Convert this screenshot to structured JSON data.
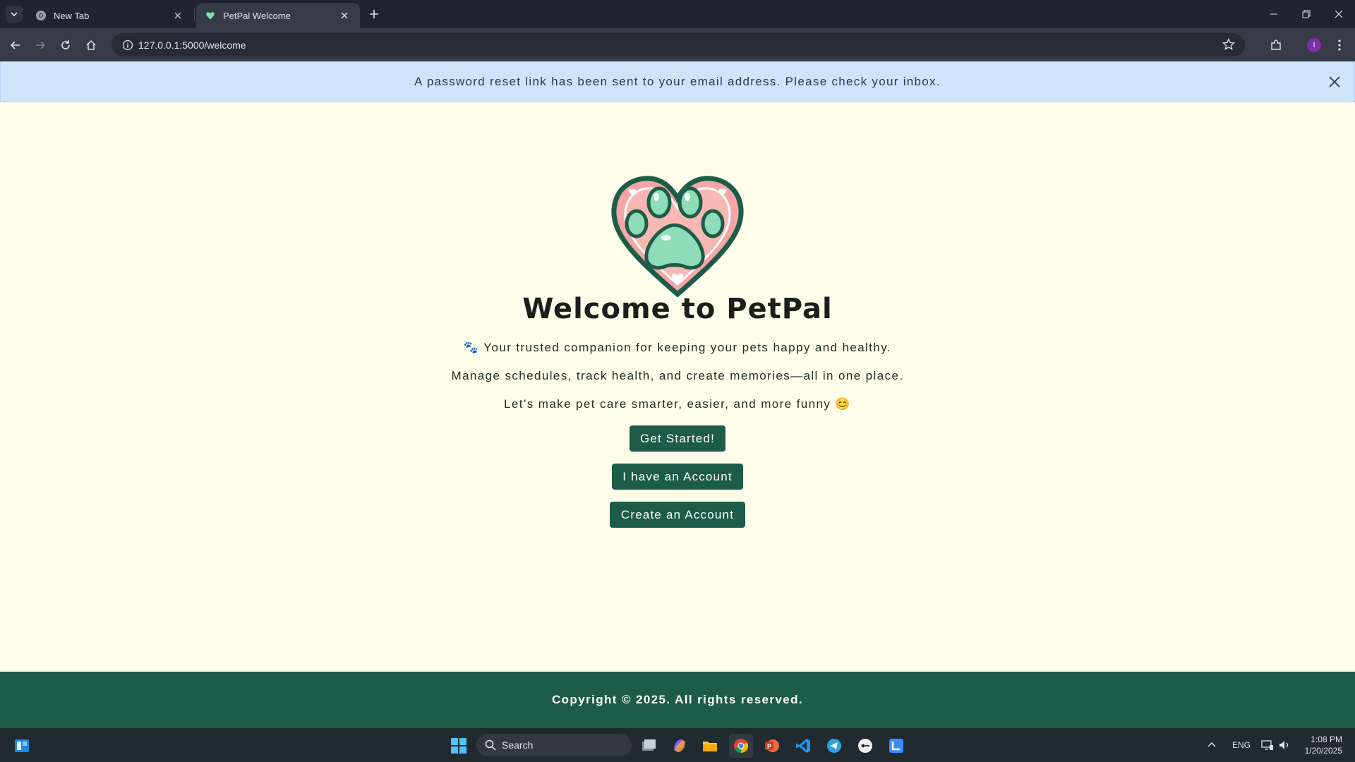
{
  "browser": {
    "tabs": [
      {
        "title": "New Tab",
        "active": false
      },
      {
        "title": "PetPal Welcome",
        "active": true
      }
    ],
    "url": "127.0.0.1:5000/welcome",
    "profile_initial": "I"
  },
  "flash": {
    "message": "A password reset link has been sent to your email address. Please check your inbox."
  },
  "hero": {
    "title": "Welcome to PetPal",
    "line1": "🐾 Your trusted companion for keeping your pets happy and healthy.",
    "line2": "Manage schedules, track health, and create memories—all in one place.",
    "line3": "Let’s make pet care smarter, easier, and more funny 😊"
  },
  "buttons": {
    "get_started": "Get Started!",
    "have_account": "I have an Account",
    "create_account": "Create an Account"
  },
  "footer": {
    "text": "Copyright © 2025. All rights reserved."
  },
  "taskbar": {
    "search_placeholder": "Search",
    "language": "ENG",
    "time": "1:08 PM",
    "date": "1/20/2025"
  },
  "colors": {
    "page_bg": "#fefde9",
    "brand_green": "#1c5c48",
    "flash_bg": "#cfe3fb"
  }
}
